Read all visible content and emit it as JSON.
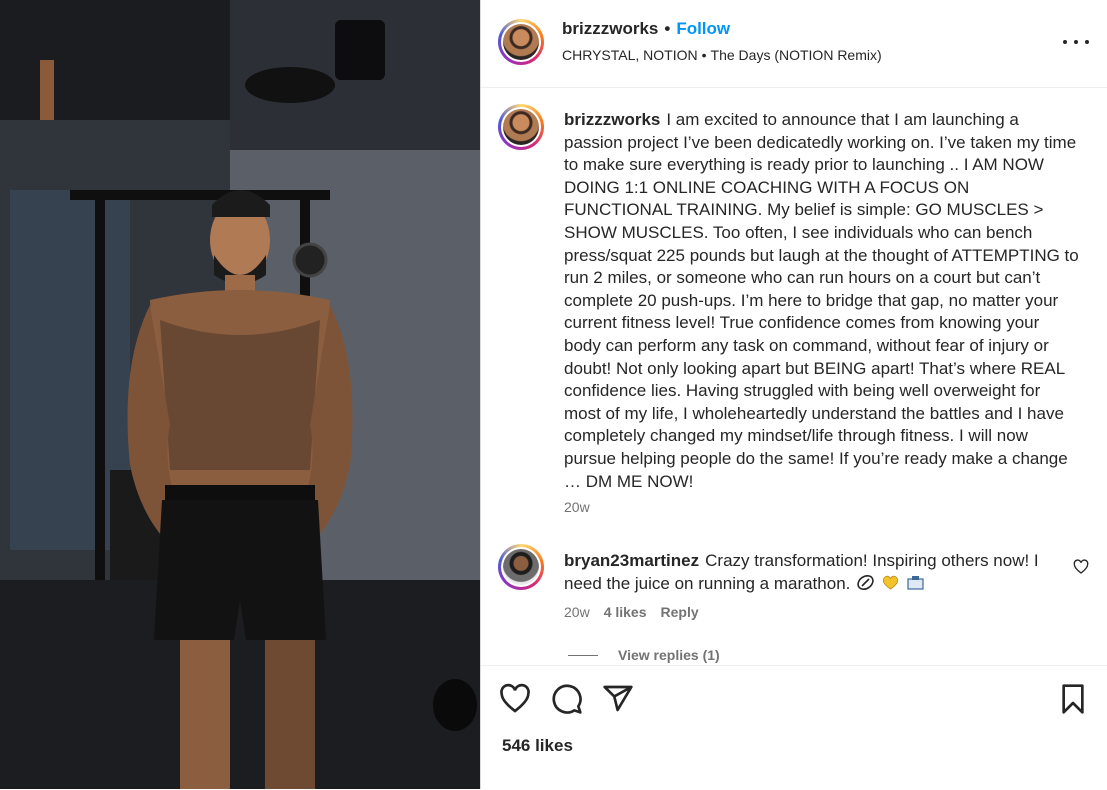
{
  "post": {
    "author": "brizzzworks",
    "follow_label": "Follow",
    "separator": "•",
    "audio_artist": "CHRYSTAL, NOTION",
    "audio_track": "The Days (NOTION Remix)"
  },
  "caption": {
    "username": "brizzzworks",
    "text": "I am excited to announce that I am launching a passion project I’ve been dedicatedly working on. I’ve taken my time to make sure everything is ready prior to launching .. I AM NOW DOING 1:1 ONLINE COACHING WITH A FOCUS ON FUNCTIONAL TRAINING. My belief is simple: GO MUSCLES > SHOW MUSCLES. Too often, I see individuals who can bench press/squat 225 pounds but laugh at the thought of ATTEMPTING to run 2 miles, or someone who can run hours on a court but can’t complete 20 push-ups. I’m here to bridge that gap, no matter your current fitness level! True confidence comes from knowing your body can perform any task on command, without fear of injury or doubt! Not only looking apart but BEING apart! That’s where REAL confidence lies. Having struggled with being well overweight for most of my life, I wholeheartedly understand the battles and I have completely changed my mindset/life through fitness. I will now pursue helping people do the same! If you’re ready make a change … DM ME NOW!",
    "time": "20w"
  },
  "comment": {
    "username": "bryan23martinez",
    "text": "Crazy transformation! Inspiring others now! I need the juice on running a marathon.",
    "emojis": [
      "pill-icon",
      "yellow-heart-icon",
      "box-icon"
    ],
    "time": "20w",
    "likes": "4 likes",
    "reply_label": "Reply",
    "view_replies": "View replies (1)"
  },
  "actions": {
    "icons": [
      "heart-icon",
      "comment-icon",
      "share-icon",
      "bookmark-icon"
    ],
    "likes_count": "546 likes"
  },
  "colors": {
    "link_blue": "#0095f6",
    "text": "#262626",
    "muted": "#737373"
  }
}
